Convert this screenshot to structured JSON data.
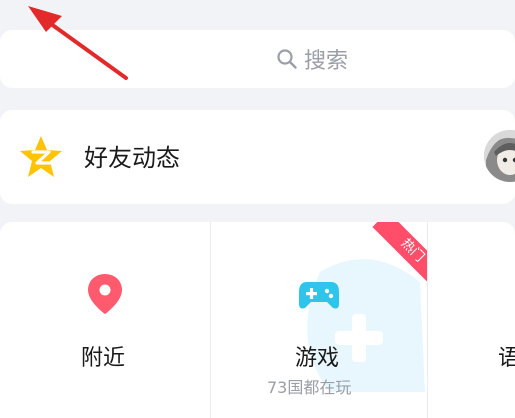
{
  "search": {
    "placeholder_text": "搜索",
    "icon": "search-icon"
  },
  "friend_feed": {
    "label": "好友动态",
    "icon": "qzone-star-icon",
    "avatar": "avatar"
  },
  "grid": {
    "items": [
      {
        "label": "附近",
        "sub": "",
        "icon": "location-pin-icon"
      },
      {
        "label": "游戏",
        "sub": "73国都在玩",
        "icon": "gamepad-icon",
        "badge": "热门"
      },
      {
        "label": "语",
        "sub": "",
        "icon": ""
      }
    ]
  },
  "colors": {
    "accent_red": "#ff4d6a",
    "game_blue": "#2fc4ec",
    "star_yellow": "#ffc300",
    "muted_text": "#9a9ea6"
  }
}
